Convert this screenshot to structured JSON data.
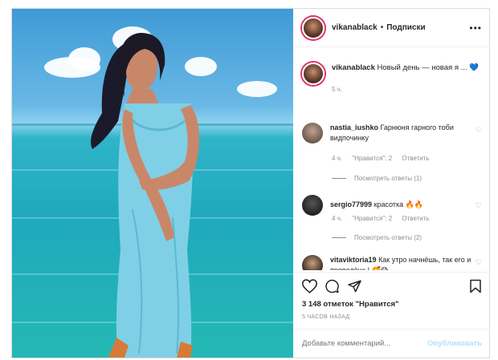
{
  "header": {
    "username": "vikanablack",
    "separator": "•",
    "follow_label": "Подписки",
    "more_label": "•••"
  },
  "caption": {
    "username": "vikanablack",
    "text": "Новый день — новая я ...",
    "emoji": "💙",
    "time": "5 ч."
  },
  "comments": [
    {
      "username": "nastia_iushko",
      "text": "Гарнюня гарного тоби видпочинку",
      "time": "4 ч.",
      "likes": "\"Нравится\": 2",
      "reply": "Ответить",
      "view_replies": "Посмотреть ответы (1)"
    },
    {
      "username": "sergio77999",
      "text": "красотка",
      "emoji": "🔥🔥",
      "time": "4 ч.",
      "likes": "\"Нравится\": 2",
      "reply": "Ответить",
      "view_replies": "Посмотреть ответы (2)"
    },
    {
      "username": "vitaviktoria19",
      "text": "Как утро начнёшь, так его и проведёшь!",
      "emoji": "🥰😱"
    }
  ],
  "actions": {
    "likes_text": "3 148 отметок \"Нравится\"",
    "time_text": "5 ЧАСОВ НАЗАД",
    "icons": [
      "heart-icon",
      "comment-icon",
      "share-icon",
      "bookmark-icon"
    ]
  },
  "add_comment": {
    "placeholder": "Добавьте комментарий...",
    "publish_label": "Опубликовать"
  },
  "colors": {
    "accent_link": "#b2dffc",
    "text": "#262626",
    "muted": "#8e8e8e",
    "border": "#dbdbdb"
  }
}
